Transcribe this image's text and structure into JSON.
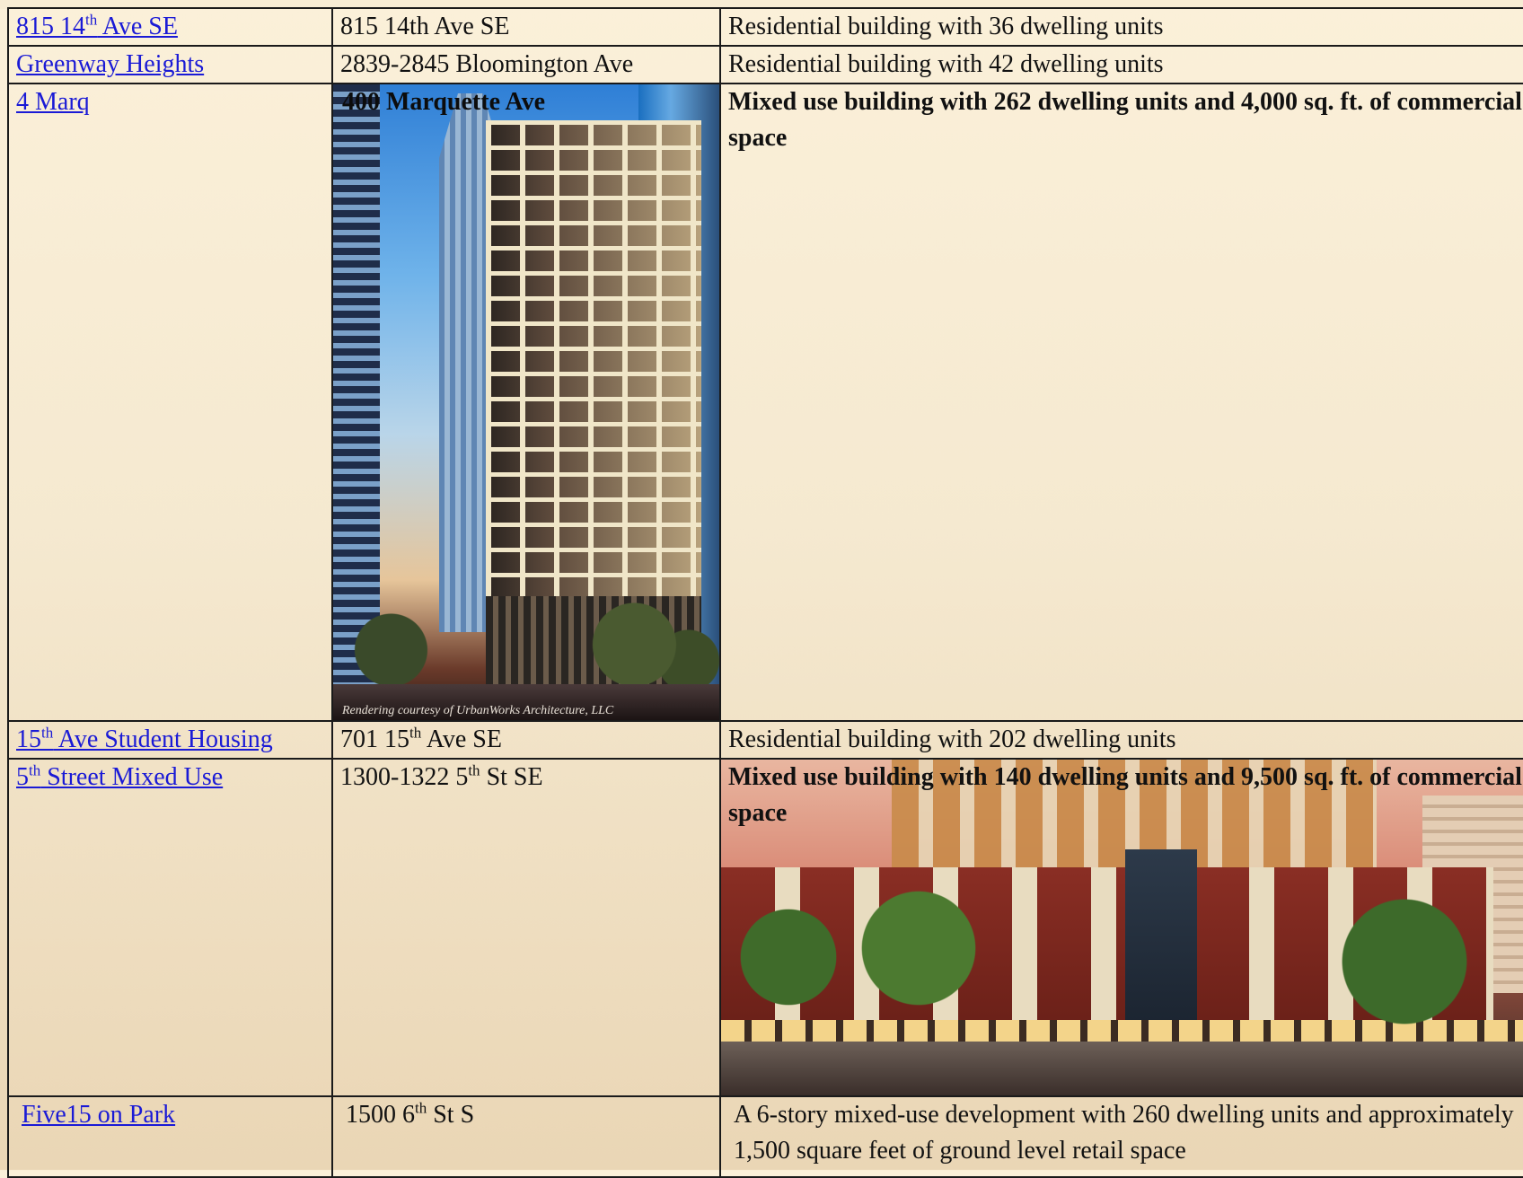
{
  "rows": [
    {
      "name": "815 14",
      "name_sup": "th",
      "name_rest": " Ave SE",
      "address": "815 14th Ave SE",
      "description": "Residential building with 36 dwelling units"
    },
    {
      "name": "Greenway Heights",
      "address": "2839-2845 Bloomington Ave",
      "description": "Residential building with 42 dwelling units"
    },
    {
      "name": "4 Marq",
      "address": "400 Marquette Ave",
      "description": "Mixed use building with 262 dwelling units and 4,000 sq. ft. of commercial space",
      "image_credit": "Rendering courtesy of UrbanWorks Architecture, LLC"
    },
    {
      "name_sup_lead": "15",
      "name_sup": "th",
      "name_rest": " Ave Student Housing",
      "address_lead": "701 15",
      "address_sup": "th",
      "address_rest": " Ave SE",
      "description": "Residential building with 202 dwelling units"
    },
    {
      "name_sup_lead": "5",
      "name_sup": "th",
      "name_rest": " Street Mixed Use",
      "address_lead": "1300-1322 5",
      "address_sup": "th",
      "address_rest": " St SE",
      "description": "Mixed use building with 140 dwelling units and 9,500 sq. ft. of commercial space"
    },
    {
      "name": "Five15 on Park",
      "address_lead": "1500 6",
      "address_sup": "th",
      "address_rest": " St S",
      "description": "A 6-story mixed-use development with 260 dwelling units and approximately 1,500 square feet of ground level retail space"
    }
  ]
}
